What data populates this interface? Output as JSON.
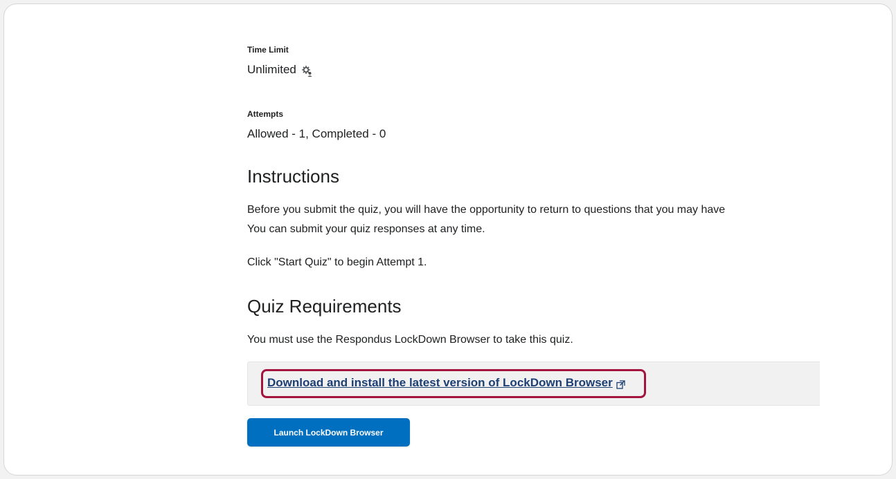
{
  "quiz": {
    "time_limit": {
      "label": "Time Limit",
      "value": "Unlimited",
      "icon": "gear-person-icon"
    },
    "attempts": {
      "label": "Attempts",
      "value": "Allowed - 1, Completed - 0"
    }
  },
  "instructions": {
    "heading": "Instructions",
    "paragraph_line_1": "Before you submit the quiz, you will have the opportunity to return to questions that you may have",
    "paragraph_line_2": "You can submit your quiz responses at any time.",
    "start_note": "Click \"Start Quiz\" to begin Attempt 1."
  },
  "requirements": {
    "heading": "Quiz Requirements",
    "description": "You must use the Respondus LockDown Browser to take this quiz.",
    "download_link": "Download and install the latest version of LockDown Browser",
    "download_icon": "external-link-icon",
    "launch_button": "Launch LockDown Browser"
  },
  "colors": {
    "link": "#1d3f73",
    "highlight_border": "#a3153f",
    "primary_button": "#006fbf",
    "panel_background": "#f1f1f2"
  }
}
